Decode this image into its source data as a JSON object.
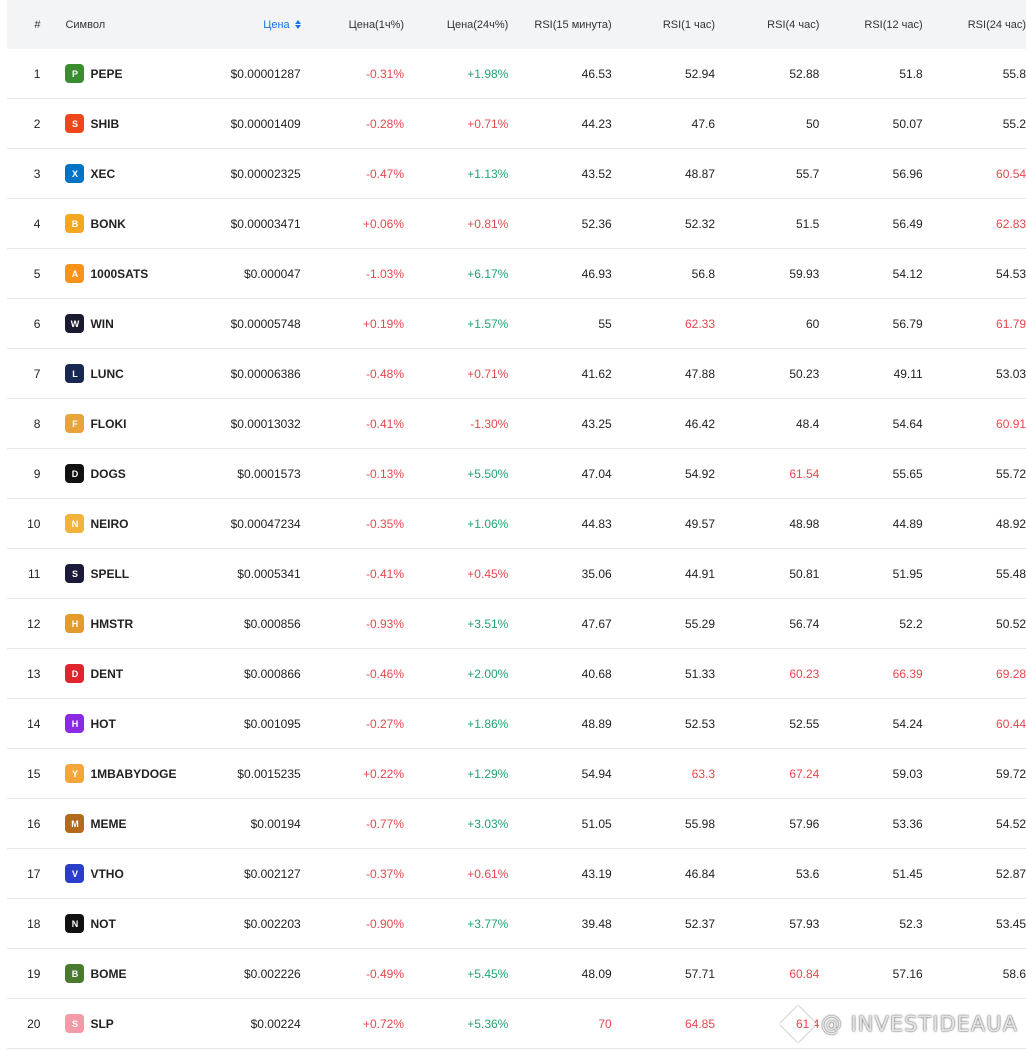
{
  "header": {
    "index": "#",
    "symbol": "Символ",
    "price": "Цена",
    "price_1h": "Цена(1ч%)",
    "price_24h": "Цена(24ч%)",
    "rsi_15m": "RSI(15 минута)",
    "rsi_1h": "RSI(1 час)",
    "rsi_4h": "RSI(4 час)",
    "rsi_12h": "RSI(12 час)",
    "rsi_24h": "RSI(24 час)"
  },
  "colors": {
    "negative": "#e5484d",
    "positive": "#1ea672",
    "accent": "#1a73e8",
    "header_bg": "#f3f4f6"
  },
  "rows": [
    {
      "idx": "1",
      "sym": "PEPE",
      "icon": "pepe-icon",
      "ic": "#3b8e2f",
      "price": "$0.00001287",
      "p1": "-0.31%",
      "p24": "+1.98%",
      "r15": "46.53",
      "r1": "52.94",
      "r4": "52.88",
      "r12": "51.8",
      "r24": "55.8",
      "p24c": "pos",
      "hot": []
    },
    {
      "idx": "2",
      "sym": "SHIB",
      "icon": "shib-icon",
      "ic": "#f0461c",
      "price": "$0.00001409",
      "p1": "-0.28%",
      "p24": "+0.71%",
      "r15": "44.23",
      "r1": "47.6",
      "r4": "50",
      "r12": "50.07",
      "r24": "55.2",
      "p24c": "neg",
      "hot": []
    },
    {
      "idx": "3",
      "sym": "XEC",
      "icon": "xec-icon",
      "ic": "#0074c2",
      "price": "$0.00002325",
      "p1": "-0.47%",
      "p24": "+1.13%",
      "r15": "43.52",
      "r1": "48.87",
      "r4": "55.7",
      "r12": "56.96",
      "r24": "60.54",
      "p24c": "pos",
      "hot": [
        "r24"
      ]
    },
    {
      "idx": "4",
      "sym": "BONK",
      "icon": "bonk-icon",
      "ic": "#f5a623",
      "price": "$0.00003471",
      "p1": "+0.06%",
      "p24": "+0.81%",
      "r15": "52.36",
      "r1": "52.32",
      "r4": "51.5",
      "r12": "56.49",
      "r24": "62.83",
      "p24c": "neg",
      "hot": [
        "r24"
      ]
    },
    {
      "idx": "5",
      "sym": "1000SATS",
      "icon": "sats-icon",
      "ic": "#f7931a",
      "price": "$0.000047",
      "p1": "-1.03%",
      "p24": "+6.17%",
      "r15": "46.93",
      "r1": "56.8",
      "r4": "59.93",
      "r12": "54.12",
      "r24": "54.53",
      "p24c": "pos",
      "hot": []
    },
    {
      "idx": "6",
      "sym": "WIN",
      "icon": "win-icon",
      "ic": "#1b1b2f",
      "price": "$0.00005748",
      "p1": "+0.19%",
      "p24": "+1.57%",
      "r15": "55",
      "r1": "62.33",
      "r4": "60",
      "r12": "56.79",
      "r24": "61.79",
      "p24c": "pos",
      "hot": [
        "r1",
        "r24"
      ]
    },
    {
      "idx": "7",
      "sym": "LUNC",
      "icon": "lunc-icon",
      "ic": "#172852",
      "price": "$0.00006386",
      "p1": "-0.48%",
      "p24": "+0.71%",
      "r15": "41.62",
      "r1": "47.88",
      "r4": "50.23",
      "r12": "49.11",
      "r24": "53.03",
      "p24c": "neg",
      "hot": []
    },
    {
      "idx": "8",
      "sym": "FLOKI",
      "icon": "floki-icon",
      "ic": "#e8a33d",
      "price": "$0.00013032",
      "p1": "-0.41%",
      "p24": "-1.30%",
      "r15": "43.25",
      "r1": "46.42",
      "r4": "48.4",
      "r12": "54.64",
      "r24": "60.91",
      "p24c": "neg",
      "hot": [
        "r24"
      ]
    },
    {
      "idx": "9",
      "sym": "DOGS",
      "icon": "dogs-icon",
      "ic": "#111111",
      "price": "$0.0001573",
      "p1": "-0.13%",
      "p24": "+5.50%",
      "r15": "47.04",
      "r1": "54.92",
      "r4": "61.54",
      "r12": "55.65",
      "r24": "55.72",
      "p24c": "pos",
      "hot": [
        "r4"
      ]
    },
    {
      "idx": "10",
      "sym": "NEIRO",
      "icon": "neiro-icon",
      "ic": "#f2b33d",
      "price": "$0.00047234",
      "p1": "-0.35%",
      "p24": "+1.06%",
      "r15": "44.83",
      "r1": "49.57",
      "r4": "48.98",
      "r12": "44.89",
      "r24": "48.92",
      "p24c": "pos",
      "hot": []
    },
    {
      "idx": "11",
      "sym": "SPELL",
      "icon": "spell-icon",
      "ic": "#1c1a3a",
      "price": "$0.0005341",
      "p1": "-0.41%",
      "p24": "+0.45%",
      "r15": "35.06",
      "r1": "44.91",
      "r4": "50.81",
      "r12": "51.95",
      "r24": "55.48",
      "p24c": "neg",
      "hot": []
    },
    {
      "idx": "12",
      "sym": "HMSTR",
      "icon": "hmstr-icon",
      "ic": "#e39b2b",
      "price": "$0.000856",
      "p1": "-0.93%",
      "p24": "+3.51%",
      "r15": "47.67",
      "r1": "55.29",
      "r4": "56.74",
      "r12": "52.2",
      "r24": "50.52",
      "p24c": "pos",
      "hot": []
    },
    {
      "idx": "13",
      "sym": "DENT",
      "icon": "dent-icon",
      "ic": "#e1252e",
      "price": "$0.000866",
      "p1": "-0.46%",
      "p24": "+2.00%",
      "r15": "40.68",
      "r1": "51.33",
      "r4": "60.23",
      "r12": "66.39",
      "r24": "69.28",
      "p24c": "pos",
      "hot": [
        "r4",
        "r12",
        "r24"
      ]
    },
    {
      "idx": "14",
      "sym": "HOT",
      "icon": "hot-icon",
      "ic": "#8a2be2",
      "price": "$0.001095",
      "p1": "-0.27%",
      "p24": "+1.86%",
      "r15": "48.89",
      "r1": "52.53",
      "r4": "52.55",
      "r12": "54.24",
      "r24": "60.44",
      "p24c": "pos",
      "hot": [
        "r24"
      ]
    },
    {
      "idx": "15",
      "sym": "1MBABYDOGE",
      "icon": "babydoge-icon",
      "ic": "#f4a63a",
      "price": "$0.0015235",
      "p1": "+0.22%",
      "p24": "+1.29%",
      "r15": "54.94",
      "r1": "63.3",
      "r4": "67.24",
      "r12": "59.03",
      "r24": "59.72",
      "p24c": "pos",
      "hot": [
        "r1",
        "r4"
      ]
    },
    {
      "idx": "16",
      "sym": "MEME",
      "icon": "meme-icon",
      "ic": "#b36b1b",
      "price": "$0.00194",
      "p1": "-0.77%",
      "p24": "+3.03%",
      "r15": "51.05",
      "r1": "55.98",
      "r4": "57.96",
      "r12": "53.36",
      "r24": "54.52",
      "p24c": "pos",
      "hot": []
    },
    {
      "idx": "17",
      "sym": "VTHO",
      "icon": "vtho-icon",
      "ic": "#2a3ec9",
      "price": "$0.002127",
      "p1": "-0.37%",
      "p24": "+0.61%",
      "r15": "43.19",
      "r1": "46.84",
      "r4": "53.6",
      "r12": "51.45",
      "r24": "52.87",
      "p24c": "neg",
      "hot": []
    },
    {
      "idx": "18",
      "sym": "NOT",
      "icon": "not-icon",
      "ic": "#111111",
      "price": "$0.002203",
      "p1": "-0.90%",
      "p24": "+3.77%",
      "r15": "39.48",
      "r1": "52.37",
      "r4": "57.93",
      "r12": "52.3",
      "r24": "53.45",
      "p24c": "pos",
      "hot": []
    },
    {
      "idx": "19",
      "sym": "BOME",
      "icon": "bome-icon",
      "ic": "#4a7a2e",
      "price": "$0.002226",
      "p1": "-0.49%",
      "p24": "+5.45%",
      "r15": "48.09",
      "r1": "57.71",
      "r4": "60.84",
      "r12": "57.16",
      "r24": "58.6",
      "p24c": "pos",
      "hot": [
        "r4"
      ]
    },
    {
      "idx": "20",
      "sym": "SLP",
      "icon": "slp-icon",
      "ic": "#f29aa8",
      "price": "$0.00224",
      "p1": "+0.72%",
      "p24": "+5.36%",
      "r15": "70",
      "r1": "64.85",
      "r4": "61.4",
      "r12": "",
      "r24": "",
      "p24c": "pos",
      "hot": [
        "r15",
        "r1",
        "r4"
      ]
    }
  ],
  "watermark": "@ INVESTIDEAUA"
}
